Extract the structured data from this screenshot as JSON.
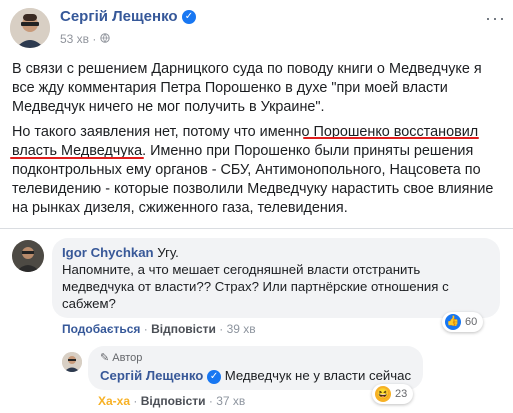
{
  "post": {
    "author": "Сергій Лещенко",
    "time": "53 хв",
    "paragraph1": "В связи с решением Дарницкого суда по поводу книги о Медведчуке я все жду комментария Петра Порошенко в духе \"при моей власти Медведчук ничего не мог получить в Украине\".",
    "paragraph2_a": "Но такого заявления нет, потому что именно ",
    "paragraph2_highlight": "Порошенко восстановил власть Медведчука",
    "paragraph2_b": ". Именно при Порошенко были приняты решения подконтрольных ему органов - СБУ, Антимонопольного, Нацсовета по телевидению - которые позволили Медведчуку нарастить свое влияние на рынках дизеля, сжиженного газа, телевидения.",
    "more_icon": "more-dots-icon",
    "audience_icon": "globe-icon"
  },
  "comment1": {
    "author": "Igor Chychkan",
    "text_inline": "Угу.",
    "text": "Напомните, а что мешает сегодняшней власти отстранить медведчука от власти?? Страх? Или партнёрские отношения с сабжем?",
    "reaction_label": "Подобається",
    "reply_label": "Відповісти",
    "time": "39 хв",
    "likes": "60"
  },
  "reply1": {
    "badge": "Автор",
    "author": "Сергій Лещенко",
    "text": "Медведчук не у власти сейчас",
    "reaction_label": "Ха-ха",
    "reply_label": "Відповісти",
    "time": "37 хв",
    "reactions": "23"
  },
  "colors": {
    "accent": "#385898",
    "underline": "#e01e1e",
    "haha": "#f7b125",
    "like": "#1877f2"
  }
}
